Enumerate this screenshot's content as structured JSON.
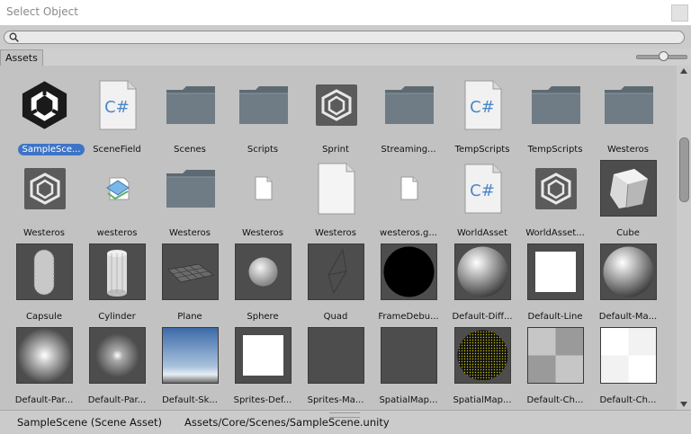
{
  "window": {
    "title": "Select Object"
  },
  "search": {
    "placeholder": "",
    "value": ""
  },
  "tabs": {
    "assets": "Assets"
  },
  "zoom": {
    "value": 0.55
  },
  "colors": {
    "selection": "#3e74c6",
    "thumb_bg": "#4d4d4d",
    "panel_bg": "#c2c2c2"
  },
  "rows": [
    [
      {
        "label": "SampleSce...",
        "icon": "unity-scene-icon",
        "selected": true
      },
      {
        "label": "SceneField",
        "icon": "csharp-script-icon"
      },
      {
        "label": "Scenes",
        "icon": "folder-icon"
      },
      {
        "label": "Scripts",
        "icon": "folder-icon"
      },
      {
        "label": "Sprint",
        "icon": "unity-scene-small-icon"
      },
      {
        "label": "Streaming...",
        "icon": "folder-icon"
      },
      {
        "label": "TempScripts",
        "icon": "csharp-script-icon"
      },
      {
        "label": "TempScripts",
        "icon": "folder-icon"
      },
      {
        "label": "Westeros",
        "icon": "folder-icon"
      }
    ],
    [
      {
        "label": "Westeros",
        "icon": "unity-scene-small-icon"
      },
      {
        "label": "westeros",
        "icon": "lighting-data-icon"
      },
      {
        "label": "Westeros",
        "icon": "folder-icon"
      },
      {
        "label": "Westeros",
        "icon": "small-document-icon"
      },
      {
        "label": "Westeros",
        "icon": "large-document-icon"
      },
      {
        "label": "westeros.g...",
        "icon": "small-document-icon"
      },
      {
        "label": "WorldAsset",
        "icon": "csharp-script-icon"
      },
      {
        "label": "WorldAsset...",
        "icon": "unity-scene-small-icon"
      },
      {
        "label": "Cube",
        "icon": "cube-mesh-icon"
      }
    ],
    [
      {
        "label": "Capsule",
        "icon": "capsule-mesh-icon"
      },
      {
        "label": "Cylinder",
        "icon": "cylinder-mesh-icon"
      },
      {
        "label": "Plane",
        "icon": "plane-mesh-icon"
      },
      {
        "label": "Sphere",
        "icon": "sphere-mesh-icon"
      },
      {
        "label": "Quad",
        "icon": "quad-mesh-icon"
      },
      {
        "label": "FrameDebu...",
        "icon": "black-sphere-material-icon"
      },
      {
        "label": "Default-Diff...",
        "icon": "grey-sphere-material-icon"
      },
      {
        "label": "Default-Line",
        "icon": "white-square-material-icon"
      },
      {
        "label": "Default-Ma...",
        "icon": "grey-sphere-material-icon"
      }
    ],
    [
      {
        "label": "Default-Par...",
        "icon": "particle-glow-icon"
      },
      {
        "label": "Default-Par...",
        "icon": "particle-glow-small-icon"
      },
      {
        "label": "Default-Sk...",
        "icon": "skybox-icon"
      },
      {
        "label": "Sprites-Def...",
        "icon": "white-square-material-icon"
      },
      {
        "label": "Sprites-Ma...",
        "icon": "empty-material-icon"
      },
      {
        "label": "SpatialMap...",
        "icon": "empty-material-icon"
      },
      {
        "label": "SpatialMap...",
        "icon": "wireframe-sphere-icon"
      },
      {
        "label": "Default-Ch...",
        "icon": "checker-grey-icon"
      },
      {
        "label": "Default-Ch...",
        "icon": "checker-white-icon"
      }
    ]
  ],
  "status": {
    "name": "SampleScene (Scene Asset)",
    "path": "Assets/Core/Scenes/SampleScene.unity"
  }
}
